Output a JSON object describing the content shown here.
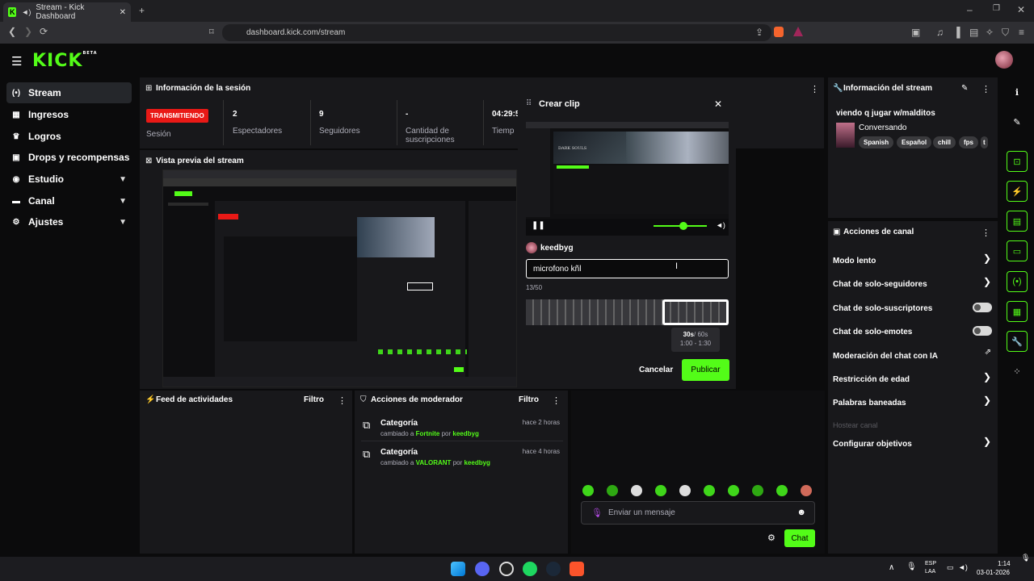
{
  "browser": {
    "tab_title": "Stream - Kick Dashboard",
    "url": "dashboard.kick.com/stream"
  },
  "app": {
    "logo": "KICK",
    "logo_badge": "BETA"
  },
  "sidebar": {
    "items": [
      {
        "label": "Stream",
        "icon": "live-icon",
        "active": true
      },
      {
        "label": "Ingresos",
        "icon": "revenue-icon"
      },
      {
        "label": "Logros",
        "icon": "trophy-icon"
      },
      {
        "label": "Drops y recompensas",
        "icon": "gift-icon"
      },
      {
        "label": "Estudio",
        "icon": "studio-icon",
        "expandable": true
      },
      {
        "label": "Canal",
        "icon": "channel-icon",
        "expandable": true
      },
      {
        "label": "Ajustes",
        "icon": "gear-icon",
        "expandable": true
      }
    ]
  },
  "session": {
    "title": "Información de la sesión",
    "status_badge": "TRANSMITIENDO",
    "status_label": "Sesión",
    "stats": [
      {
        "value": "2",
        "label": "Espectadores"
      },
      {
        "value": "9",
        "label": "Seguidores"
      },
      {
        "value": "-",
        "label": "Cantidad de suscripciones"
      },
      {
        "value": "04:29:5",
        "label": "Tiemp"
      }
    ]
  },
  "preview": {
    "title": "Vista previa del stream"
  },
  "activity_feed": {
    "title": "Feed de actividades",
    "filter": "Filtro"
  },
  "mod_actions": {
    "title": "Acciones de moderador",
    "filter": "Filtro",
    "items": [
      {
        "title": "Categoría",
        "prefix": "cambiado a",
        "game": "Fortnite",
        "by": "por",
        "user": "keedbyg",
        "time": "hace 2 horas"
      },
      {
        "title": "Categoría",
        "prefix": "cambiado a",
        "game": "VALORANT",
        "by": "por",
        "user": "keedbyg",
        "time": "hace 4 horas"
      }
    ]
  },
  "clip_modal": {
    "title": "Crear clip",
    "username": "keedbyg",
    "input_value": "microfono kñl",
    "char_count": "13/50",
    "duration_main": "30s",
    "duration_max": "/ 60s",
    "range": "1:00 - 1:30",
    "cancel": "Cancelar",
    "publish": "Publicar",
    "video_caption": "DARK SOULS",
    "volume_level": 0.6
  },
  "chat": {
    "placeholder": "Enviar un mensaje",
    "send": "Chat"
  },
  "stream_info": {
    "title": "Información del stream",
    "stream_title": "viendo q jugar w/malditos",
    "category": "Conversando",
    "tags": [
      "Spanish",
      "Español",
      "chill",
      "fps",
      "t"
    ]
  },
  "channel_actions": {
    "title": "Acciones de canal",
    "items": [
      {
        "label": "Modo lento",
        "control": "chevron"
      },
      {
        "label": "Chat de solo-seguidores",
        "control": "chevron"
      },
      {
        "label": "Chat de solo-suscriptores",
        "control": "toggle"
      },
      {
        "label": "Chat de solo-emotes",
        "control": "toggle"
      },
      {
        "label": "Moderación del chat con IA",
        "control": "external"
      },
      {
        "label": "Restricción de edad",
        "control": "chevron"
      },
      {
        "label": "Palabras baneadas",
        "control": "chevron"
      },
      {
        "label": "Hostear canal",
        "control": "none",
        "disabled": true
      },
      {
        "label": "Configurar objetivos",
        "control": "chevron"
      }
    ]
  },
  "taskbar": {
    "lang": "ESP",
    "lang2": "LAA",
    "time": "1:14",
    "date": "03-01-2026"
  },
  "colors": {
    "accent": "#53fc18",
    "live": "#e91916",
    "panel": "#18181b"
  }
}
